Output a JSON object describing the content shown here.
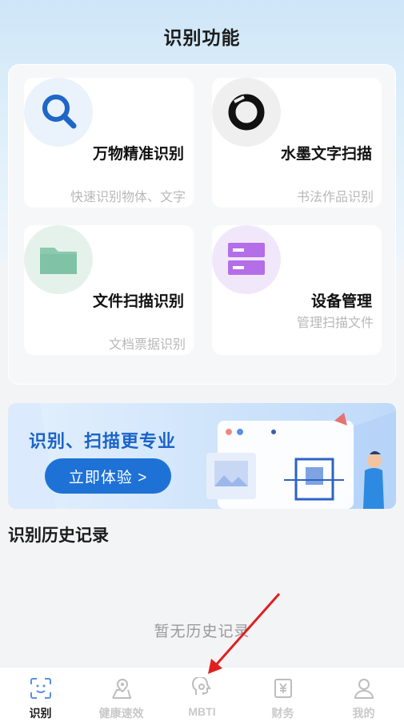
{
  "header": {
    "title": "识别功能"
  },
  "features": [
    {
      "title": "万物精准识别",
      "subtitle": "快速识别物体、文字",
      "icon": "search-icon"
    },
    {
      "title": "水墨文字扫描",
      "subtitle": "书法作品识别",
      "icon": "ink-circle-icon"
    },
    {
      "title": "文件扫描识别",
      "subtitle": "文档票据识别",
      "icon": "folder-icon"
    },
    {
      "title": "设备管理",
      "subtitle": "管理扫描文件",
      "icon": "server-icon"
    }
  ],
  "banner": {
    "title": "识别、扫描更专业",
    "button_label": "立即体验 >"
  },
  "history": {
    "title": "识别历史记录",
    "empty_text": "暂无历史记录"
  },
  "tabs": [
    {
      "label": "识别",
      "icon": "scan-face-icon",
      "active": true
    },
    {
      "label": "健康速效",
      "icon": "location-pin-icon",
      "active": false
    },
    {
      "label": "MBTI",
      "icon": "brain-head-icon",
      "active": false
    },
    {
      "label": "财务",
      "icon": "yen-receipt-icon",
      "active": false
    },
    {
      "label": "我的",
      "icon": "user-icon",
      "active": false
    }
  ],
  "colors": {
    "accent": "#1e72d6",
    "banner_title": "#1b63c8",
    "arrow": "#e02020"
  }
}
